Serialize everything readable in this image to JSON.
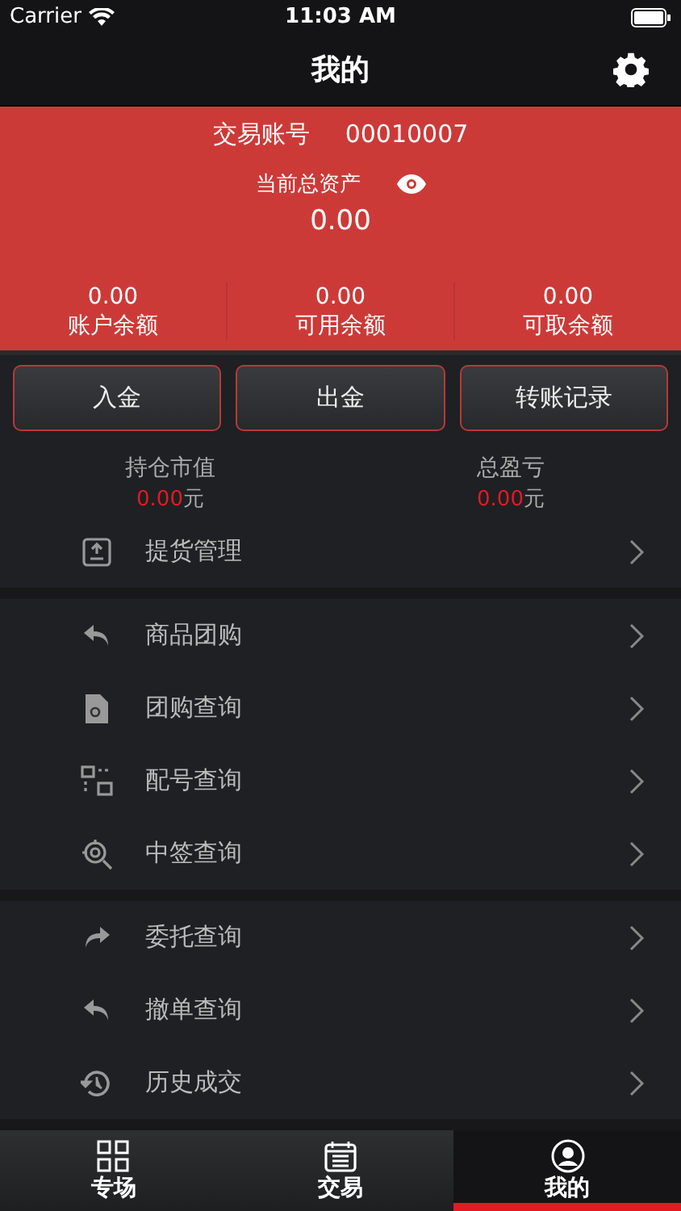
{
  "status_bar": {
    "carrier": "Carrier",
    "time": "11:03 AM"
  },
  "nav": {
    "title": "我的"
  },
  "account": {
    "label": "交易账号",
    "number": "00010007",
    "assets_label": "当前总资产",
    "assets": "0.00",
    "balances": [
      {
        "value": "0.00",
        "label": "账户余额"
      },
      {
        "value": "0.00",
        "label": "可用余额"
      },
      {
        "value": "0.00",
        "label": "可取余额"
      }
    ]
  },
  "buttons": [
    "入金",
    "出金",
    "转账记录"
  ],
  "stats": [
    {
      "label": "持仓市值",
      "value": "0.00",
      "unit": "元"
    },
    {
      "label": "总盈亏",
      "value": "0.00",
      "unit": "元"
    }
  ],
  "menu_groups": [
    [
      {
        "kind": "pickup",
        "label": "提货管理"
      }
    ],
    [
      {
        "kind": "reply",
        "label": "商品团购"
      },
      {
        "kind": "doc",
        "label": "团购查询"
      },
      {
        "kind": "grid",
        "label": "配号查询"
      },
      {
        "kind": "target",
        "label": "中签查询"
      }
    ],
    [
      {
        "kind": "forward",
        "label": "委托查询"
      },
      {
        "kind": "reply",
        "label": "撤单查询"
      },
      {
        "kind": "history",
        "label": "历史成交"
      }
    ]
  ],
  "tabs": [
    {
      "kind": "grid",
      "label": "专场",
      "selected": false
    },
    {
      "kind": "calendar",
      "label": "交易",
      "selected": false
    },
    {
      "kind": "user",
      "label": "我的",
      "selected": true
    }
  ]
}
